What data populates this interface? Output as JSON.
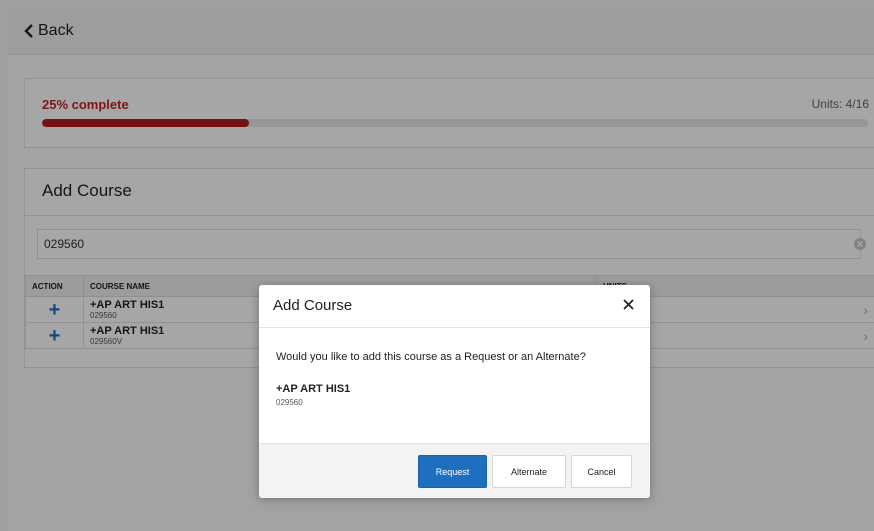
{
  "nav": {
    "back_label": "Back"
  },
  "progress": {
    "label": "25% complete",
    "percent": 25,
    "units_text": "Units: 4/16",
    "fill_color": "#b71c1c"
  },
  "add_course": {
    "title": "Add Course",
    "search_value": "029560",
    "columns": [
      "ACTION",
      "COURSE NAME",
      "UNITS"
    ],
    "rows": [
      {
        "action_icon": "plus-icon",
        "name": "+AP ART HIS1",
        "code": "029560"
      },
      {
        "action_icon": "plus-icon",
        "name": "+AP ART HIS1",
        "code": "029560V"
      }
    ]
  },
  "modal": {
    "title": "Add Course",
    "question": "Would you like to add this course as a Request or an Alternate?",
    "course_name": "+AP ART HIS1",
    "course_code": "029560",
    "buttons": {
      "request": "Request",
      "alternate": "Alternate",
      "cancel": "Cancel"
    },
    "primary_color": "#1e6fbf"
  }
}
